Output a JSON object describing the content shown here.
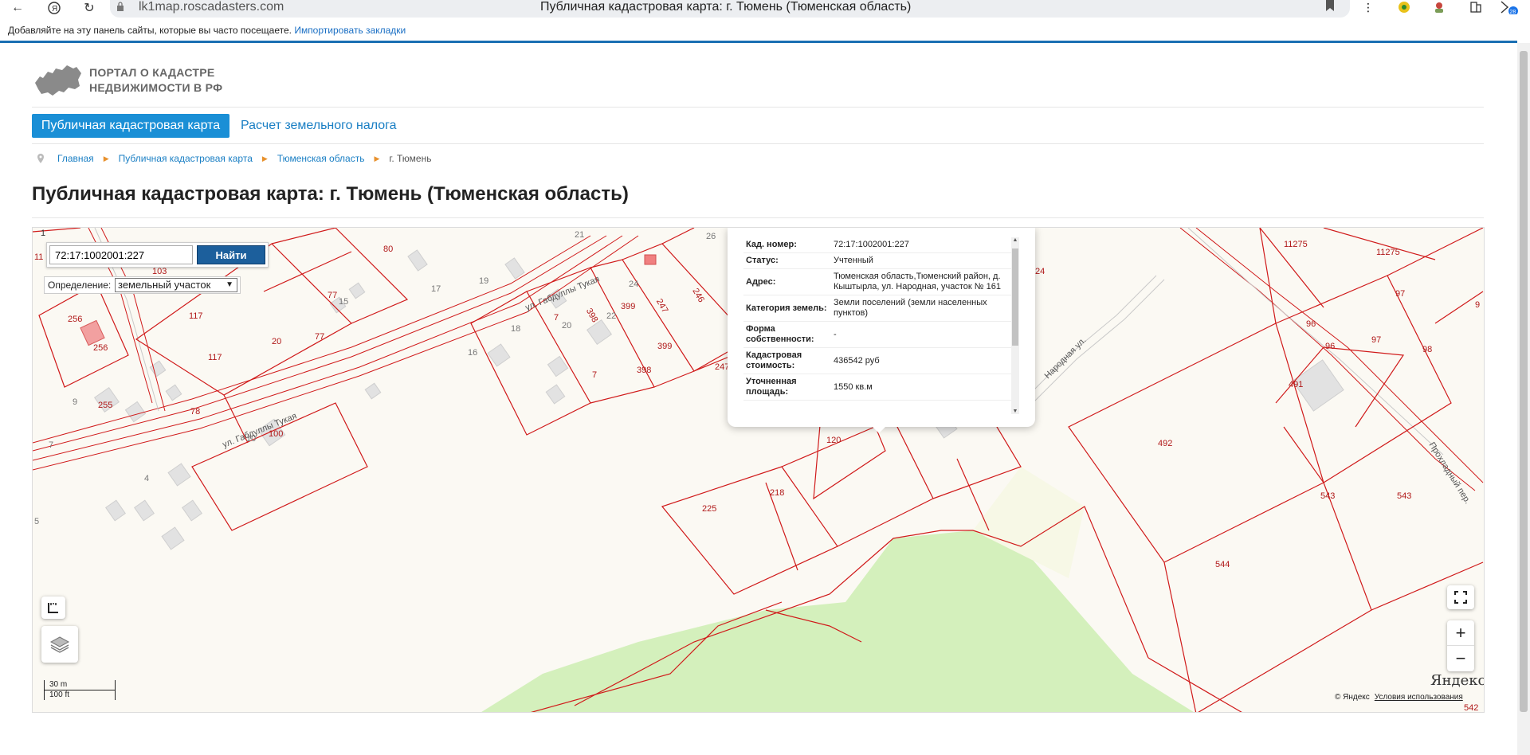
{
  "browser": {
    "url": "lk1map.roscadasters.com",
    "tab_title": "Публичная кадастровая карта: г. Тюмень (Тюменская область)",
    "bookmarks_text": "Добавляйте на эту панель сайты, которые вы часто посещаете.",
    "bookmarks_link": "Импортировать закладки",
    "badge_count": "28"
  },
  "logo": {
    "line1": "ПОРТАЛ О КАДАСТРЕ",
    "line2": "НЕДВИЖИМОСТИ В РФ"
  },
  "tabs": {
    "active": "Публичная кадастровая карта",
    "other": "Расчет земельного налога"
  },
  "breadcrumb": {
    "items": [
      "Главная",
      "Публичная кадастровая карта",
      "Тюменская область"
    ],
    "current": "г. Тюмень"
  },
  "page_title": "Публичная кадастровая карта: г. Тюмень (Тюменская область)",
  "map": {
    "search_value": "72:17:1002001:227",
    "search_button": "Найти",
    "definition_label": "Определение:",
    "definition_value": "земельный участок",
    "scale_m": "30 m",
    "scale_ft": "100 ft",
    "copyright": "© Яндекс",
    "terms": "Условия использования",
    "provider_logo": "Яндекс",
    "colors": {
      "parcel_line": "#d01a1a",
      "park": "#d4f0bc",
      "land": "#fbf9f3"
    }
  },
  "popup": {
    "rows": [
      {
        "k": "Кад. номер:",
        "v": "72:17:1002001:227"
      },
      {
        "k": "Статус:",
        "v": "Учтенный"
      },
      {
        "k": "Адрес:",
        "v": "Тюменская область,Тюменский район, д. Кыштырла, ул. Народная, участок № 161"
      },
      {
        "k": "Категория земель:",
        "v": "Земли поселений (земли населенных пунктов)"
      },
      {
        "k": "Форма собственности:",
        "v": "-"
      },
      {
        "k": "Кадастровая стоимость:",
        "v": "436542 руб"
      },
      {
        "k": "Уточненная площадь:",
        "v": "1550 кв.м"
      }
    ]
  },
  "map_labels": {
    "streets": [
      "ул. Габдуллы Тукая",
      "ул. Габдуллы Тукая",
      "Народная ул.",
      "Прохладный пер."
    ],
    "parcels": [
      "80",
      "21",
      "26",
      "11275",
      "11275",
      "103",
      "7",
      "17",
      "19",
      "24",
      "246",
      "97",
      "9",
      "77",
      "15",
      "247",
      "399",
      "398",
      "22",
      "256",
      "117",
      "20",
      "77",
      "7",
      "20",
      "18",
      "399",
      "96",
      "97",
      "96",
      "98",
      "256",
      "16",
      "398",
      "7",
      "247",
      "491",
      "117",
      "78",
      "9",
      "255",
      "227",
      "100",
      "10",
      "120",
      "492",
      "7",
      "4",
      "218",
      "225",
      "543",
      "543",
      "544",
      "5",
      "542",
      "1",
      "11",
      "24"
    ]
  }
}
